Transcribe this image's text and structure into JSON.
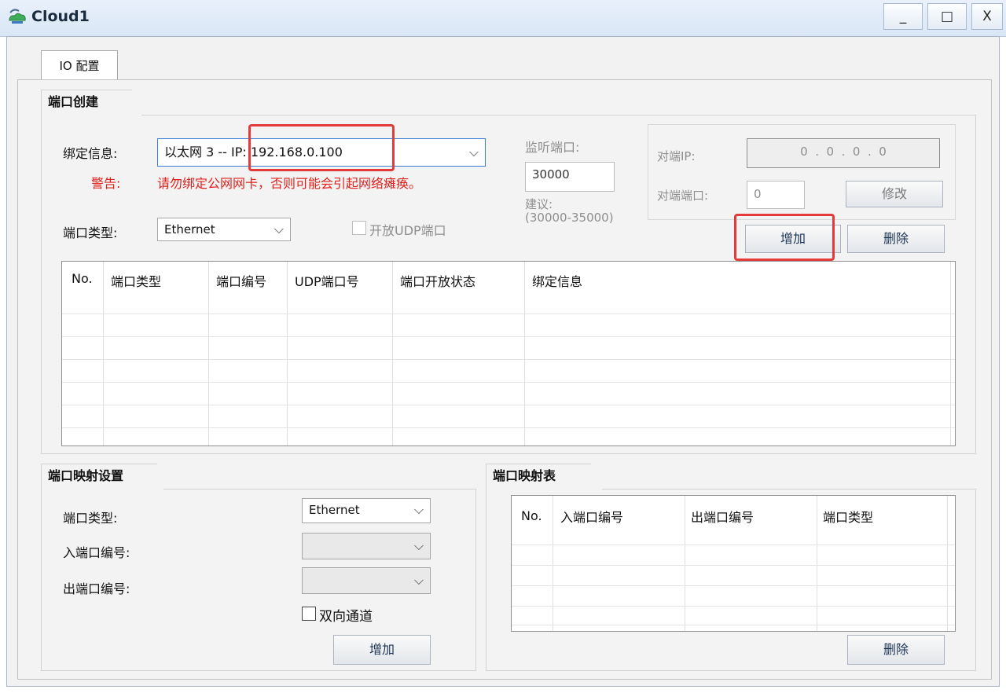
{
  "window": {
    "title": "Cloud1",
    "minimize": "_",
    "maximize": "□",
    "close": "X"
  },
  "tabs": [
    {
      "label": "IO 配置"
    }
  ],
  "port_create": {
    "title": "端口创建",
    "bind_label": "绑定信息:",
    "bind_value": "以太网 3 -- IP: 192.168.0.100",
    "warn_label": "警告:",
    "warn_text": "请勿绑定公网网卡，否则可能会引起网络瘫痪。",
    "port_type_label": "端口类型:",
    "port_type_value": "Ethernet",
    "udp_checkbox_label": "开放UDP端口",
    "listen_port_label": "监听端口:",
    "listen_port_value": "30000",
    "suggest_label": "建议:",
    "suggest_range": "(30000-35000)",
    "peer_ip_label": "对端IP:",
    "peer_ip_value": "0  .  0  .  0  .  0",
    "peer_port_label": "对端端口:",
    "peer_port_value": "0",
    "modify_button": "修改",
    "add_button": "增加",
    "delete_button": "删除",
    "table_headers": [
      "No.",
      "端口类型",
      "端口编号",
      "UDP端口号",
      "端口开放状态",
      "绑定信息"
    ]
  },
  "mapping_settings": {
    "title": "端口映射设置",
    "port_type_label": "端口类型:",
    "port_type_value": "Ethernet",
    "in_port_label": "入端口编号:",
    "out_port_label": "出端口编号:",
    "bidirectional_label": "双向通道",
    "add_button": "增加"
  },
  "mapping_table": {
    "title": "端口映射表",
    "headers": [
      "No.",
      "入端口编号",
      "出端口编号",
      "端口类型"
    ],
    "delete_button": "删除"
  },
  "colors": {
    "warning": "#e0201a",
    "highlight_box": "#e43a3a"
  }
}
